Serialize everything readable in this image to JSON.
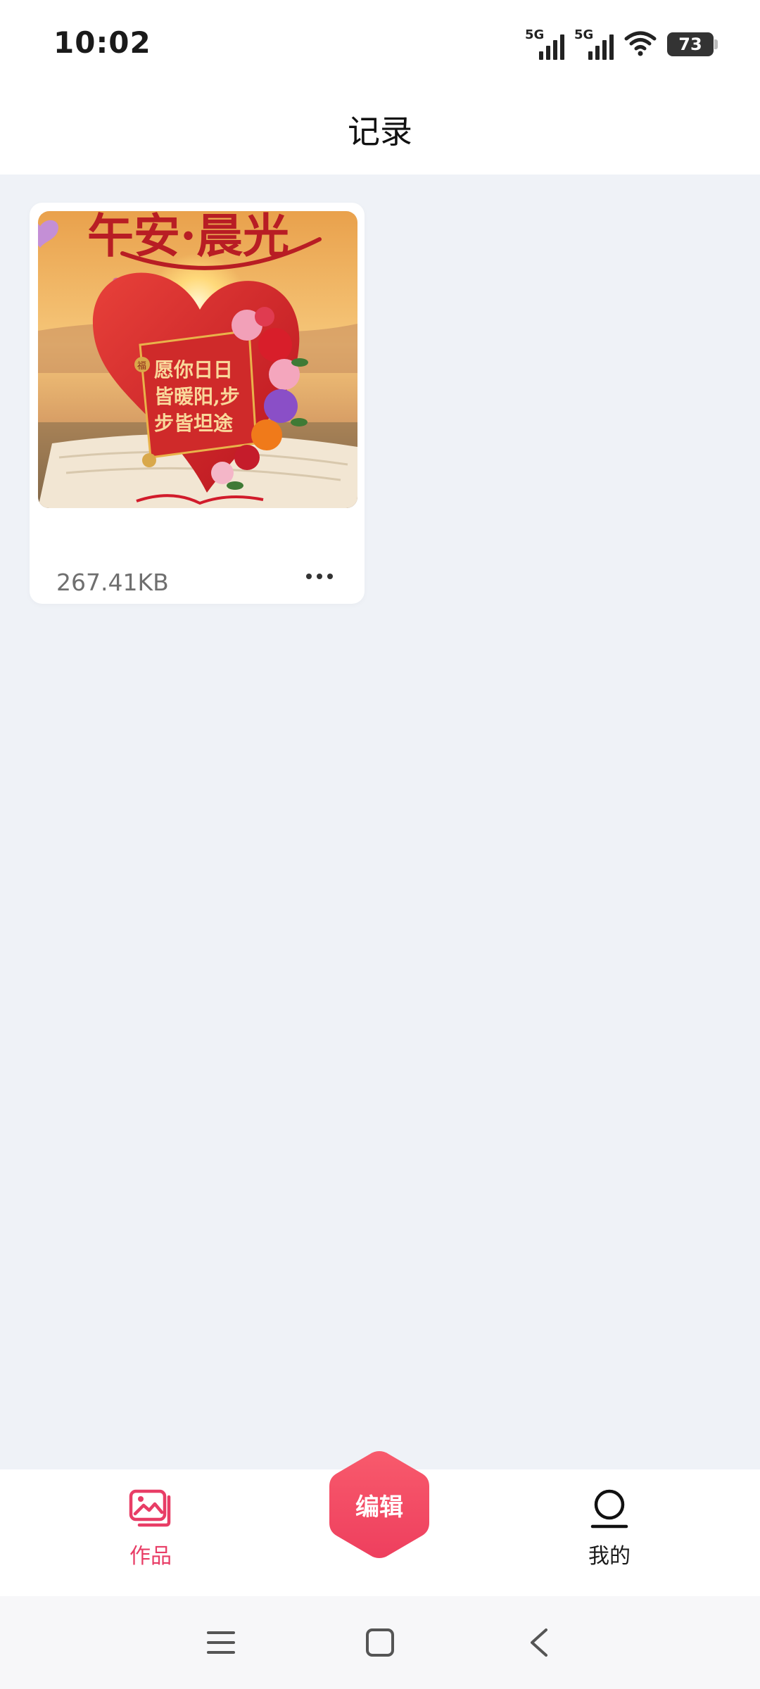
{
  "status_bar": {
    "time": "10:02",
    "signal_1_tag": "5G",
    "signal_2_tag": "5G",
    "battery_level": "73",
    "icons": [
      "5g-signal-icon",
      "5g-signal-icon",
      "wifi-icon",
      "battery-icon"
    ]
  },
  "header": {
    "title": "记录"
  },
  "works": [
    {
      "file_size": "267.41KB",
      "thumbnail": {
        "title_text": "午安·晨光",
        "heart_text_line1": "愿你日日",
        "heart_text_line2": "皆暖阳,步",
        "heart_text_line3": "步皆坦途",
        "seal_text": "福"
      },
      "more_icon": "more-horizontal-icon"
    }
  ],
  "tabbar": {
    "works_label": "作品",
    "edit_label": "编辑",
    "mine_label": "我的",
    "active_tab": "works",
    "accent_color": "#e83d66"
  },
  "system_nav": {
    "icons": [
      "menu-icon",
      "home-icon",
      "back-icon"
    ]
  }
}
